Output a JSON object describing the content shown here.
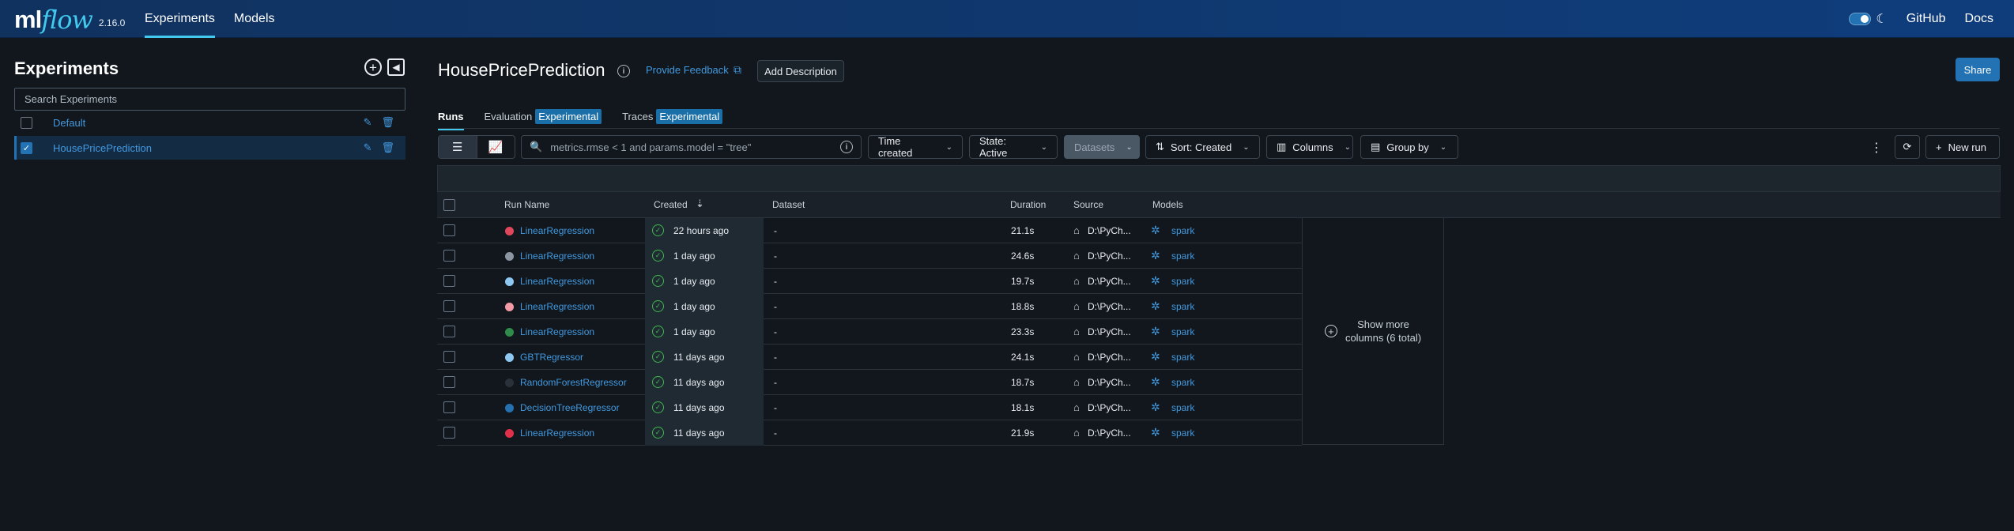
{
  "topbar": {
    "logo_ml": "ml",
    "logo_flow": "flow",
    "version": "2.16.0",
    "nav": [
      "Experiments",
      "Models"
    ],
    "links": [
      "GitHub",
      "Docs"
    ]
  },
  "sidebar": {
    "title": "Experiments",
    "search_placeholder": "Search Experiments",
    "experiments": [
      {
        "name": "Default",
        "checked": false
      },
      {
        "name": "HousePricePrediction",
        "checked": true
      }
    ]
  },
  "main": {
    "title": "HousePricePrediction",
    "feedback": "Provide Feedback",
    "add_description": "Add Description",
    "share": "Share",
    "tabs": [
      {
        "label": "Runs",
        "badge": ""
      },
      {
        "label": "Evaluation",
        "badge": "Experimental"
      },
      {
        "label": "Traces",
        "badge": "Experimental"
      }
    ],
    "toolbar": {
      "search_value": "metrics.rmse < 1 and params.model = \"tree\"",
      "time_created": "Time created",
      "state": "State: Active",
      "datasets": "Datasets",
      "sort": "Sort: Created",
      "columns": "Columns",
      "group_by": "Group by",
      "new_run": "New run"
    },
    "table": {
      "headers": [
        "Run Name",
        "Created",
        "Dataset",
        "Duration",
        "Source",
        "Models"
      ],
      "rows": [
        {
          "name": "LinearRegression",
          "color": "#e0475b",
          "created": "22 hours ago",
          "dataset": "-",
          "duration": "21.1s",
          "source": "D:\\PyCh...",
          "model": "spark"
        },
        {
          "name": "LinearRegression",
          "color": "#8c96a3",
          "created": "1 day ago",
          "dataset": "-",
          "duration": "24.6s",
          "source": "D:\\PyCh...",
          "model": "spark"
        },
        {
          "name": "LinearRegression",
          "color": "#8ec8f2",
          "created": "1 day ago",
          "dataset": "-",
          "duration": "19.7s",
          "source": "D:\\PyCh...",
          "model": "spark"
        },
        {
          "name": "LinearRegression",
          "color": "#f29aa5",
          "created": "1 day ago",
          "dataset": "-",
          "duration": "18.8s",
          "source": "D:\\PyCh...",
          "model": "spark"
        },
        {
          "name": "LinearRegression",
          "color": "#2e8b4a",
          "created": "1 day ago",
          "dataset": "-",
          "duration": "23.3s",
          "source": "D:\\PyCh...",
          "model": "spark"
        },
        {
          "name": "GBTRegressor",
          "color": "#8ec8f2",
          "created": "11 days ago",
          "dataset": "-",
          "duration": "24.1s",
          "source": "D:\\PyCh...",
          "model": "spark"
        },
        {
          "name": "RandomForestRegressor",
          "color": "#2a313a",
          "created": "11 days ago",
          "dataset": "-",
          "duration": "18.7s",
          "source": "D:\\PyCh...",
          "model": "spark"
        },
        {
          "name": "DecisionTreeRegressor",
          "color": "#2470b0",
          "created": "11 days ago",
          "dataset": "-",
          "duration": "18.1s",
          "source": "D:\\PyCh...",
          "model": "spark"
        },
        {
          "name": "LinearRegression",
          "color": "#e0304a",
          "created": "11 days ago",
          "dataset": "-",
          "duration": "21.9s",
          "source": "D:\\PyCh...",
          "model": "spark"
        }
      ],
      "more_columns_line1": "Show more",
      "more_columns_line2": "columns (6 total)"
    }
  }
}
